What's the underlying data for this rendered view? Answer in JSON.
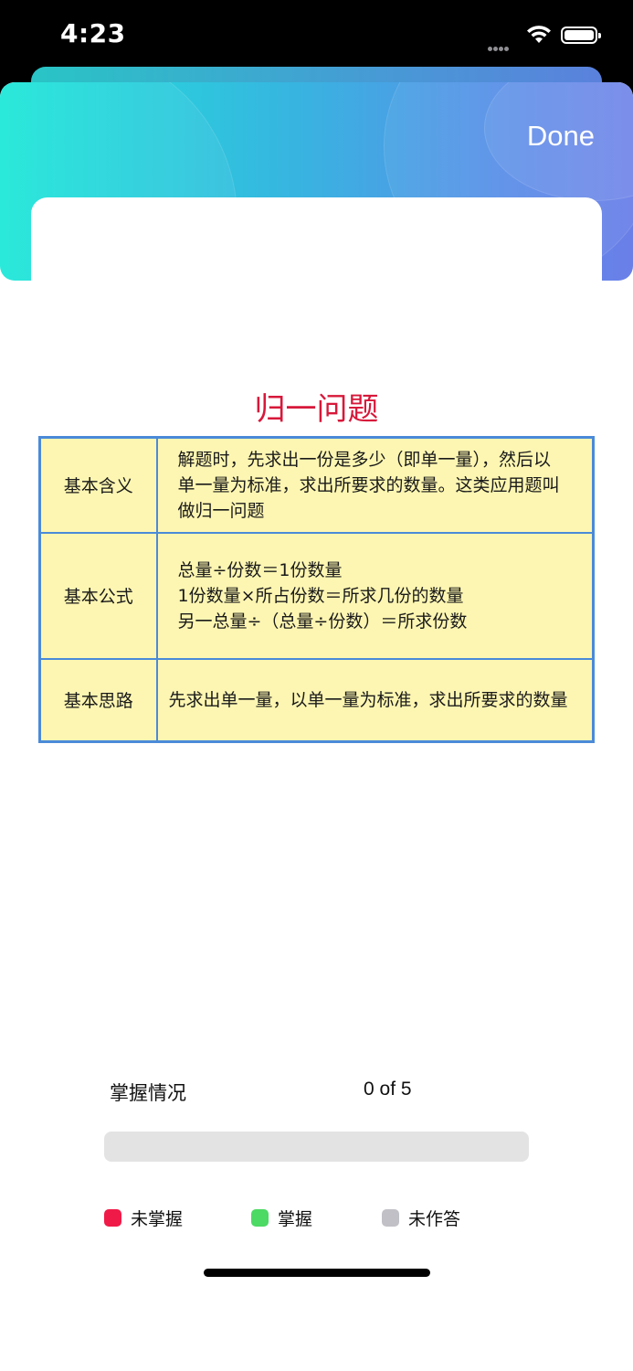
{
  "status_bar": {
    "time": "4:23"
  },
  "header": {
    "done_label": "Done",
    "gradient": [
      "#1de8d8",
      "#6a7fe8"
    ]
  },
  "document": {
    "title": "归一问题",
    "title_color": "#d7183a",
    "rows": [
      {
        "label": "基本含义",
        "lines": [
          "解题时，先求出一份是多少（即单一量），然后以",
          "单一量为标准，求出所要求的数量。这类应用题叫",
          "做归一问题"
        ]
      },
      {
        "label": "基本公式",
        "lines": [
          "总量÷份数＝1份数量",
          "1份数量×所占份数＝所求几份的数量",
          "另一总量÷（总量÷份数）＝所求份数"
        ]
      },
      {
        "label": "基本思路",
        "lines": [
          "先求出单一量，以单一量为标准，求出所要求的数量"
        ]
      }
    ]
  },
  "mastery": {
    "label": "掌握情况",
    "count_text": "0 of 5",
    "progress_fraction": 0
  },
  "legend": [
    {
      "label": "未掌握",
      "color": "#f01a48"
    },
    {
      "label": "掌握",
      "color": "#4cd964"
    },
    {
      "label": "未作答",
      "color": "#c0c0c6"
    }
  ]
}
